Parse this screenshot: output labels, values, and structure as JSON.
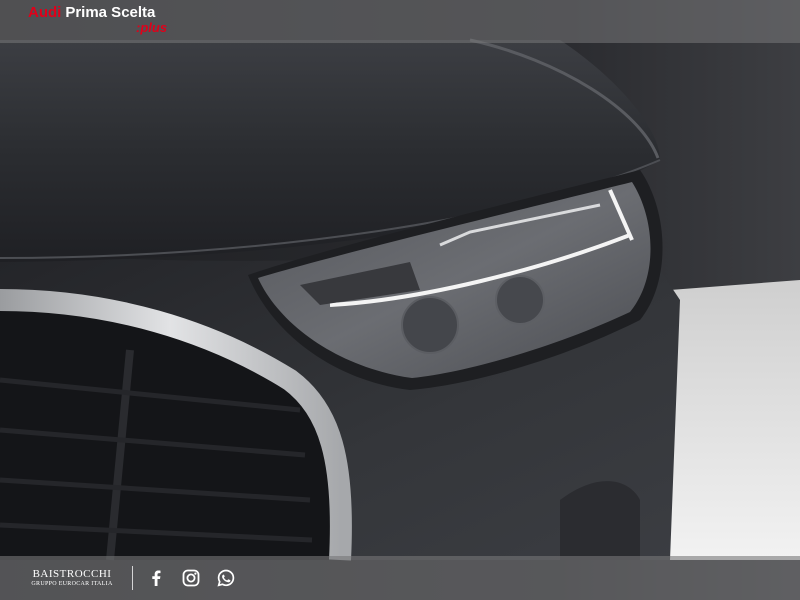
{
  "header": {
    "brand_audi": "Audi",
    "brand_prima": "Prima Scelta",
    "brand_plus": ":plus",
    "accent_color": "#e0001a"
  },
  "photo": {
    "subject": "car-headlight-icon"
  },
  "footer": {
    "dealer_name": "BAISTROCCHI",
    "dealer_sub": "GRUPPO EUROCAR ITALIA",
    "social_icons": [
      "facebook-icon",
      "instagram-icon",
      "whatsapp-icon"
    ]
  }
}
